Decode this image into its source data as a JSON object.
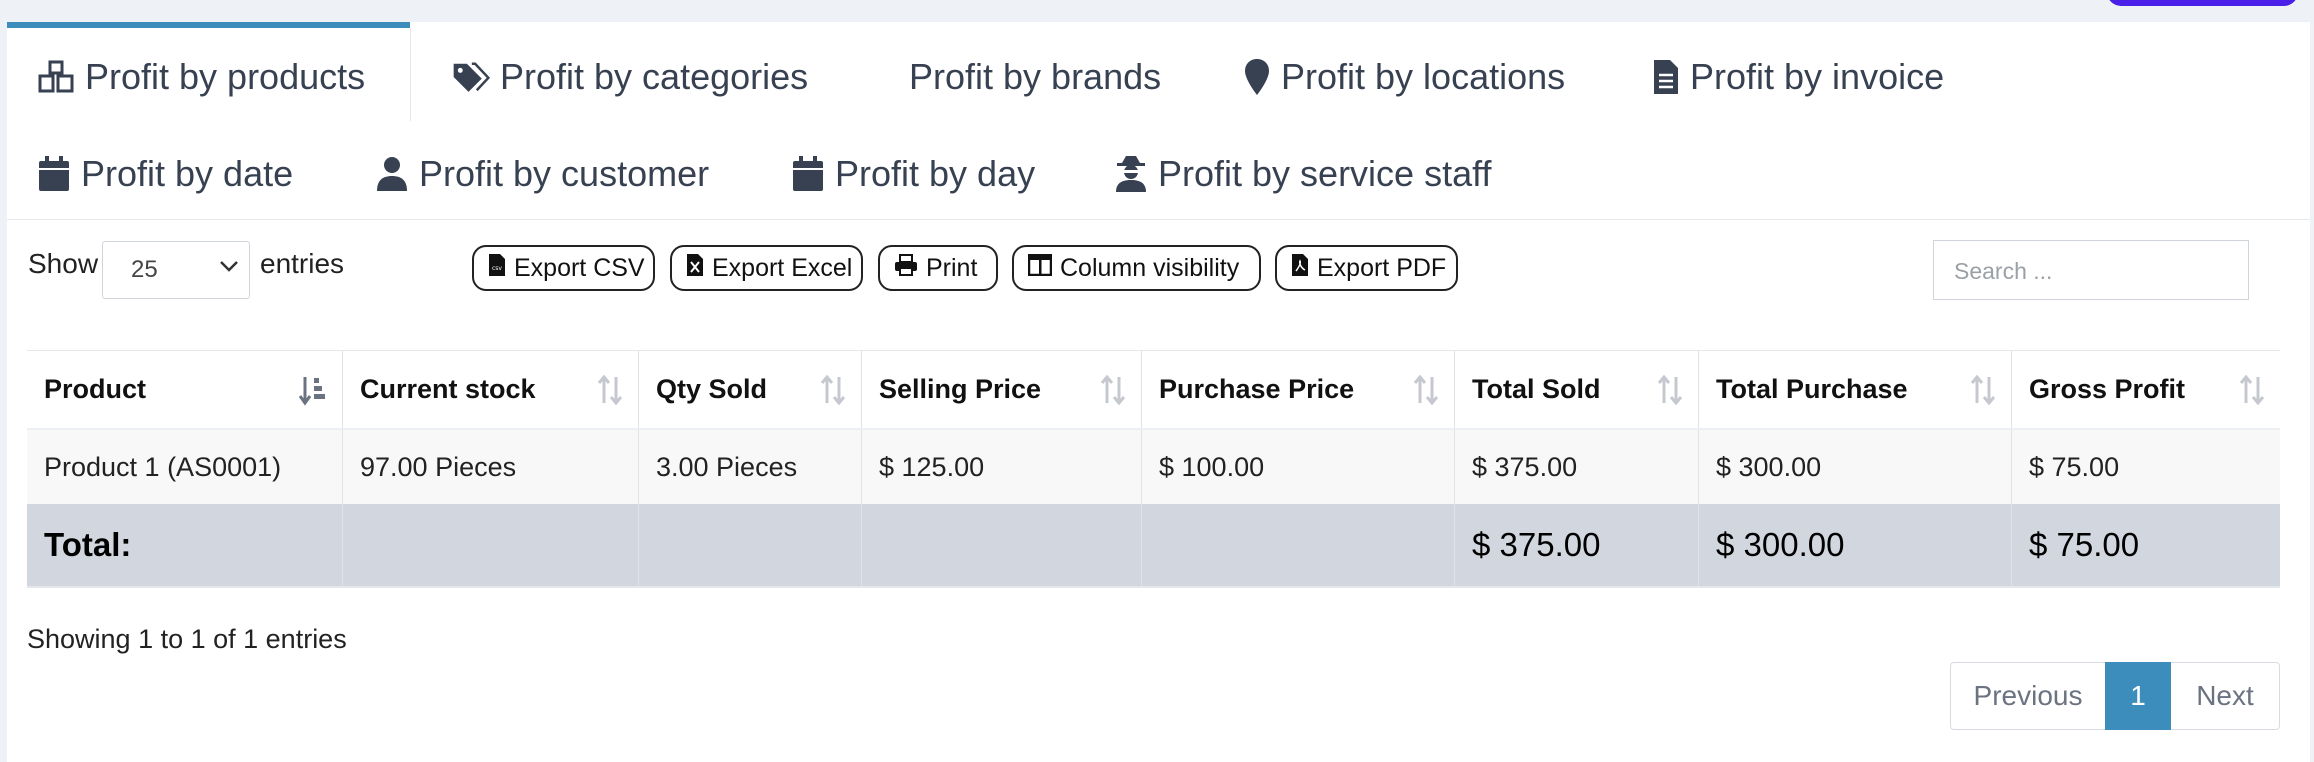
{
  "tabs": [
    {
      "label": "Profit by products",
      "icon": "cubes-icon",
      "active": true
    },
    {
      "label": "Profit by categories",
      "icon": "tags-icon"
    },
    {
      "label": "Profit by brands",
      "icon": ""
    },
    {
      "label": "Profit by locations",
      "icon": "map-marker-icon"
    },
    {
      "label": "Profit by invoice",
      "icon": "file-icon"
    },
    {
      "label": "Profit by date",
      "icon": "calendar-icon"
    },
    {
      "label": "Profit by customer",
      "icon": "user-icon"
    },
    {
      "label": "Profit by day",
      "icon": "calendar-icon"
    },
    {
      "label": "Profit by service staff",
      "icon": "user-secret-icon"
    }
  ],
  "controls": {
    "show_label": "Show",
    "entries_value": "25",
    "entries_label": "entries",
    "search_placeholder": "Search ..."
  },
  "buttons": {
    "export_csv": "Export CSV",
    "export_excel": "Export Excel",
    "print": "Print",
    "column_visibility": "Column visibility",
    "export_pdf": "Export PDF"
  },
  "table": {
    "headers": [
      "Product",
      "Current stock",
      "Qty Sold",
      "Selling Price",
      "Purchase Price",
      "Total Sold",
      "Total Purchase",
      "Gross Profit"
    ],
    "rows": [
      [
        "Product 1 (AS0001)",
        "97.00 Pieces",
        "3.00 Pieces",
        "$ 125.00",
        "$ 100.00",
        "$ 375.00",
        "$ 300.00",
        "$ 75.00"
      ]
    ],
    "total": {
      "label": "Total:",
      "total_sold": "$ 375.00",
      "total_purchase": "$ 300.00",
      "gross_profit": "$ 75.00"
    }
  },
  "footer": {
    "info": "Showing 1 to 1 of 1 entries",
    "previous": "Previous",
    "page": "1",
    "next": "Next"
  },
  "colors": {
    "accent": "#3c8dbc",
    "total_row": "#d2d6de",
    "brand_pill": "#4a1fe8"
  }
}
